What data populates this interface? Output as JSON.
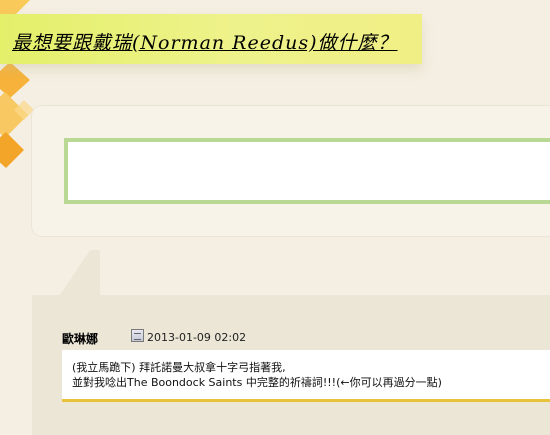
{
  "page": {
    "title": "最想要跟戴瑞(Norman Reedus)做什麼？"
  },
  "comment": {
    "author": "歐琳娜",
    "date": "2013-01-09 02:02",
    "lines": [
      "(我立馬跪下) 拜託諾曼大叔拿十字弓指著我,",
      "並對我唸出The Boondock Saints 中完整的祈禱詞!!!(←你可以再過分一點)"
    ]
  },
  "colors": {
    "banner": "#e4f06a",
    "content_border": "#b9d894",
    "comment_underline": "#e8c23a",
    "deco_orange": "#f6b23a"
  }
}
